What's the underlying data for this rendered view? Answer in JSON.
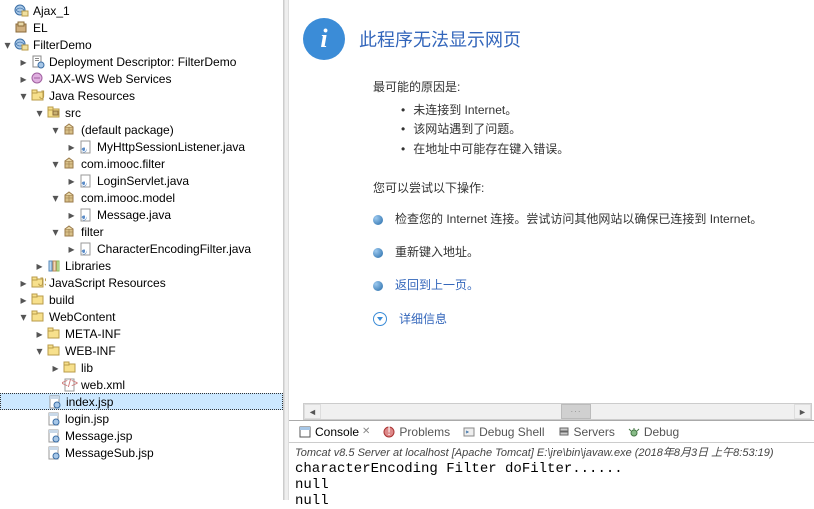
{
  "tree": [
    {
      "d": 0,
      "exp": "none",
      "icon": "proj-web",
      "label": "Ajax_1"
    },
    {
      "d": 0,
      "exp": "none",
      "icon": "proj-ear",
      "label": "EL"
    },
    {
      "d": 0,
      "exp": "open",
      "icon": "proj-web",
      "label": "FilterDemo"
    },
    {
      "d": 1,
      "exp": "close",
      "icon": "dd",
      "label": "Deployment Descriptor: FilterDemo"
    },
    {
      "d": 1,
      "exp": "close",
      "icon": "jaxws",
      "label": "JAX-WS Web Services"
    },
    {
      "d": 1,
      "exp": "open",
      "icon": "javares",
      "label": "Java Resources"
    },
    {
      "d": 2,
      "exp": "open",
      "icon": "src",
      "label": "src"
    },
    {
      "d": 3,
      "exp": "open",
      "icon": "pkg",
      "label": "(default package)"
    },
    {
      "d": 4,
      "exp": "close",
      "icon": "java",
      "label": "MyHttpSessionListener.java"
    },
    {
      "d": 3,
      "exp": "open",
      "icon": "pkg",
      "label": "com.imooc.filter"
    },
    {
      "d": 4,
      "exp": "close",
      "icon": "java",
      "label": "LoginServlet.java"
    },
    {
      "d": 3,
      "exp": "open",
      "icon": "pkg",
      "label": "com.imooc.model"
    },
    {
      "d": 4,
      "exp": "close",
      "icon": "java",
      "label": "Message.java"
    },
    {
      "d": 3,
      "exp": "open",
      "icon": "pkg",
      "label": "filter"
    },
    {
      "d": 4,
      "exp": "close",
      "icon": "java",
      "label": "CharacterEncodingFilter.java"
    },
    {
      "d": 2,
      "exp": "close",
      "icon": "lib",
      "label": "Libraries"
    },
    {
      "d": 1,
      "exp": "close",
      "icon": "jsres",
      "label": "JavaScript Resources"
    },
    {
      "d": 1,
      "exp": "close",
      "icon": "folder",
      "label": "build"
    },
    {
      "d": 1,
      "exp": "open",
      "icon": "folder",
      "label": "WebContent"
    },
    {
      "d": 2,
      "exp": "close",
      "icon": "folder",
      "label": "META-INF"
    },
    {
      "d": 2,
      "exp": "open",
      "icon": "folder",
      "label": "WEB-INF"
    },
    {
      "d": 3,
      "exp": "close",
      "icon": "folder",
      "label": "lib"
    },
    {
      "d": 3,
      "exp": "none",
      "icon": "xml",
      "label": "web.xml"
    },
    {
      "d": 2,
      "exp": "none",
      "icon": "jsp",
      "label": "index.jsp",
      "selected": true
    },
    {
      "d": 2,
      "exp": "none",
      "icon": "jsp",
      "label": "login.jsp"
    },
    {
      "d": 2,
      "exp": "none",
      "icon": "jsp",
      "label": "Message.jsp"
    },
    {
      "d": 2,
      "exp": "none",
      "icon": "jsp",
      "label": "MessageSub.jsp"
    }
  ],
  "error": {
    "title": "此程序无法显示网页",
    "reasons_title": "最可能的原因是:",
    "reasons": [
      "未连接到 Internet。",
      "该网站遇到了问题。",
      "在地址中可能存在键入错误。"
    ],
    "actions_title": "您可以尝试以下操作:",
    "action1": "检查您的 Internet 连接。尝试访问其他网站以确保已连接到 Internet。",
    "action2": "重新键入地址。",
    "action3": "返回到上一页。",
    "details": "详细信息"
  },
  "console": {
    "tabs": {
      "console": "Console",
      "problems": "Problems",
      "debugshell": "Debug Shell",
      "servers": "Servers",
      "debug": "Debug"
    },
    "status": "Tomcat v8.5 Server at localhost [Apache Tomcat] E:\\jre\\bin\\javaw.exe (2018年8月3日 上午8:53:19)",
    "output": "characterEncoding Filter doFilter......\nnull\nnull"
  }
}
